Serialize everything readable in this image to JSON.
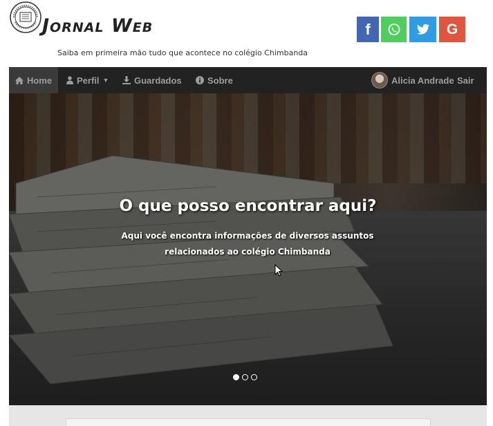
{
  "header": {
    "brand_title": "Jornal Web",
    "tagline": "Saiba em primeira mão tudo que acontece no colégio Chimbanda",
    "social": [
      {
        "name": "facebook",
        "glyph": "f",
        "color": "#3b5998"
      },
      {
        "name": "whatsapp",
        "glyph": "whatsapp-icon",
        "color": "#25d366"
      },
      {
        "name": "twitter",
        "glyph": "twitter-icon",
        "color": "#1da1f2"
      },
      {
        "name": "google",
        "glyph": "G",
        "color": "#dd4b39"
      }
    ]
  },
  "navbar": {
    "home": "Home",
    "perfil": "Perfil",
    "guardados": "Guardados",
    "sobre": "Sobre",
    "user_name": "Alicia Andrade",
    "logout": "Sair"
  },
  "hero": {
    "title": "O que posso encontrar aqui?",
    "subtitle": "Aqui você encontra informações de diversos assuntos relacionados ao colégio Chimbanda",
    "slides_total": 3,
    "active_slide": 1
  },
  "colors": {
    "navbar_bg": "#222222",
    "nav_text": "#9d9d9d",
    "facebook": "#4267b2",
    "whatsapp": "#4fce5d",
    "twitter": "#2d9de6",
    "google": "#e0553d"
  }
}
